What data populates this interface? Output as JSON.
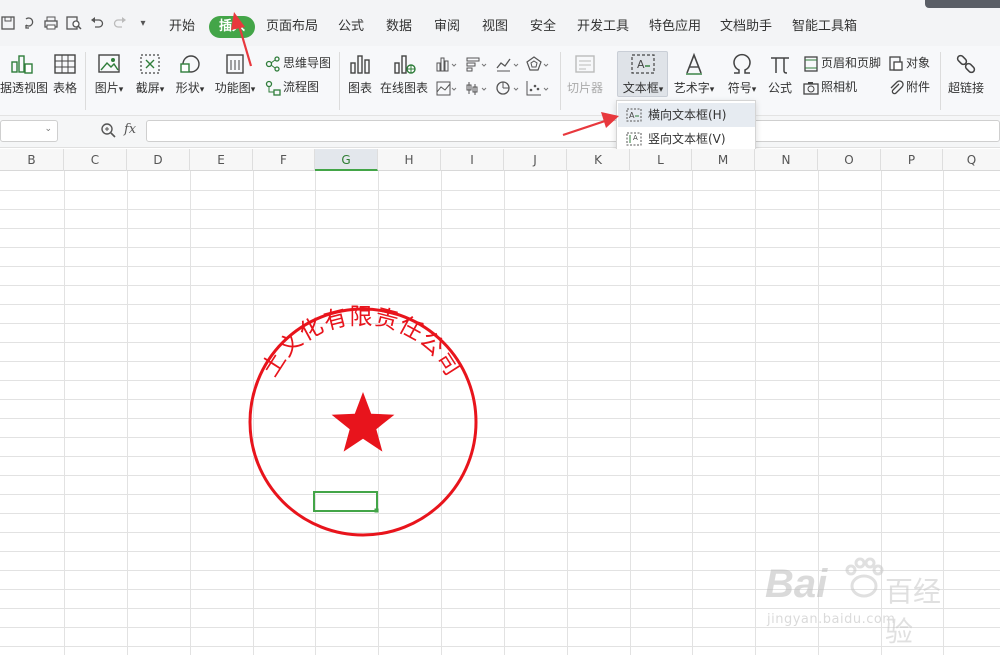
{
  "menu": {
    "tabs": [
      "开始",
      "插入",
      "页面布局",
      "公式",
      "数据",
      "审阅",
      "视图",
      "安全",
      "开发工具",
      "特色应用",
      "文档助手",
      "智能工具箱"
    ],
    "active_index": 1
  },
  "ribbon": {
    "pivot_chart": "据透视图",
    "table": "表格",
    "picture": "图片",
    "screenshot": "截屏",
    "shape": "形状",
    "function_chart": "功能图",
    "mindmap": "思维导图",
    "flowchart": "流程图",
    "chart": "图表",
    "online_chart": "在线图表",
    "slicer": "切片器",
    "textbox": "文本框",
    "wordart": "艺术字",
    "symbol": "符号",
    "formula": "公式",
    "header_footer": "页眉和页脚",
    "object": "对象",
    "camera": "照相机",
    "attachment": "附件",
    "hyperlink": "超链接",
    "dropdown_caret": "▾"
  },
  "dropdown": {
    "horizontal": "横向文本框(H)",
    "vertical": "竖向文本框(V)"
  },
  "formula_bar": {
    "fx": "fx",
    "caret": "⌄"
  },
  "sheet": {
    "columns": [
      "B",
      "C",
      "D",
      "E",
      "F",
      "G",
      "H",
      "I",
      "J",
      "K",
      "L",
      "M",
      "N",
      "O",
      "P",
      "Q"
    ],
    "selected_column": "G"
  },
  "stamp": {
    "company_text": "土文化有限责任公司",
    "color": "#e8141c"
  },
  "watermark": {
    "brand": "Bai",
    "brand_suffix": "百经验",
    "url": "jingyan.baidu.com"
  },
  "colors": {
    "accent_green": "#43a548",
    "arrow_red": "#e8383d"
  }
}
